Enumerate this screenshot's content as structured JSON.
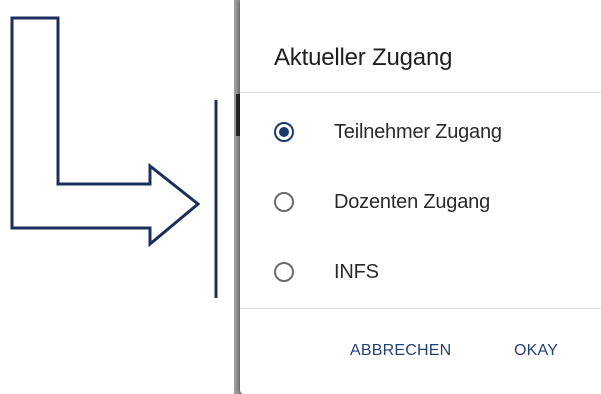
{
  "colors": {
    "accent": "#1a3a6e",
    "annotation": "#1b2f5e",
    "button_text": "#223f7a"
  },
  "dialog": {
    "title": "Aktueller Zugang",
    "options": [
      {
        "label": "Teilnehmer Zugang",
        "selected": true
      },
      {
        "label": "Dozenten Zugang",
        "selected": false
      },
      {
        "label": "INFS",
        "selected": false
      }
    ],
    "cancel_label": "ABBRECHEN",
    "ok_label": "OKAY"
  }
}
